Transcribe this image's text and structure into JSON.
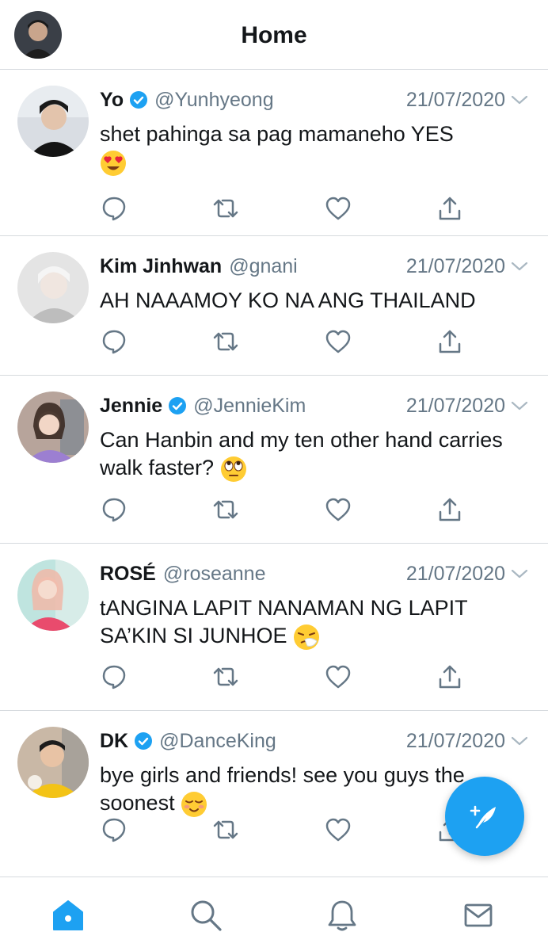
{
  "header": {
    "title": "Home"
  },
  "colors": {
    "accent": "#1da1f2",
    "text": "#14171a",
    "secondary": "#657786",
    "divider": "#d6dade"
  },
  "tweets": [
    {
      "name": "Yo",
      "verified": true,
      "handle": "@Yunhyeong",
      "date": "21/07/2020",
      "text": "shet pahinga sa pag mamaneho YES",
      "emoji": "heart-eyes"
    },
    {
      "name": "Kim Jinhwan",
      "verified": false,
      "handle": "@gnani",
      "date": "21/07/2020",
      "text": "AH NAAAMOY KO NA ANG THAILAND",
      "emoji": ""
    },
    {
      "name": "Jennie",
      "verified": true,
      "handle": "@JennieKim",
      "date": "21/07/2020",
      "text": "Can Hanbin and my ten other hand carries walk faster?",
      "emoji": "eye-roll"
    },
    {
      "name": "ROSÉ",
      "verified": false,
      "handle": "@roseanne",
      "date": "21/07/2020",
      "text": "tANGINA LAPIT NANAMAN NG LAPIT SA’KIN SI JUNHOE",
      "emoji": "sneezing"
    },
    {
      "name": "DK",
      "verified": true,
      "handle": "@DanceKing",
      "date": "21/07/2020",
      "text": "bye girls and friends! see you guys the soonest",
      "emoji": "relieved"
    }
  ],
  "tabbar": {
    "items": [
      "home-icon",
      "search-icon",
      "notifications-icon",
      "messages-icon"
    ],
    "active": 0
  }
}
